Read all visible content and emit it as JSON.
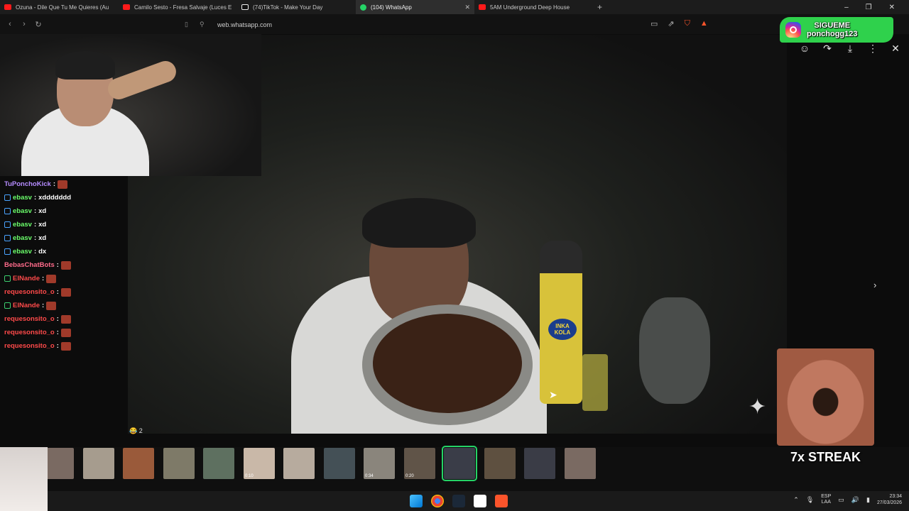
{
  "browser": {
    "tabs": [
      {
        "title": "Ozuna - Dile Que Tu Me Quieres (Au",
        "favicon": "youtube",
        "active": false
      },
      {
        "title": "Camilo Sesto - Fresa Salvaje (Luces E",
        "favicon": "youtube",
        "active": false
      },
      {
        "title": "(74)TikTok - Make Your Day",
        "favicon": "tiktok",
        "active": false
      },
      {
        "title": "(104) WhatsApp",
        "favicon": "whatsapp",
        "active": true
      },
      {
        "title": "5AM Underground Deep House",
        "favicon": "youtube",
        "active": false
      }
    ],
    "url": "web.whatsapp.com",
    "new_tab": "+",
    "window_controls": {
      "minimize": "–",
      "restore": "❐",
      "close": "✕"
    }
  },
  "viewer": {
    "reaction": "😂 2",
    "bottle_brand": "INKA KOLA",
    "thumbnails": [
      {
        "duration": ""
      },
      {
        "duration": ""
      },
      {
        "duration": ""
      },
      {
        "duration": ""
      },
      {
        "duration": ""
      },
      {
        "duration": "0:10"
      },
      {
        "duration": ""
      },
      {
        "duration": ""
      },
      {
        "duration": "0:34"
      },
      {
        "duration": "0:20"
      },
      {
        "duration": "",
        "selected": true
      },
      {
        "duration": ""
      },
      {
        "duration": ""
      },
      {
        "duration": ""
      }
    ]
  },
  "stream_overlay": {
    "promo": {
      "line1": "SIGUEME",
      "line2": "ponchogg123"
    },
    "streak": "7x STREAK",
    "chat": [
      {
        "user": "TuPonchoKick",
        "color": "purple",
        "badge": false,
        "message": "",
        "emote": true
      },
      {
        "user": "ebasv",
        "color": "green",
        "badge": true,
        "message": "xddddddd",
        "emote": false
      },
      {
        "user": "ebasv",
        "color": "green",
        "badge": true,
        "message": "xd",
        "emote": false
      },
      {
        "user": "ebasv",
        "color": "green",
        "badge": true,
        "message": "xd",
        "emote": false
      },
      {
        "user": "ebasv",
        "color": "green",
        "badge": true,
        "message": "xd",
        "emote": false
      },
      {
        "user": "ebasv",
        "color": "green",
        "badge": true,
        "message": "dx",
        "emote": false
      },
      {
        "user": "BebasChatBots",
        "color": "pink",
        "badge": false,
        "message": "",
        "emote": true
      },
      {
        "user": "ElNande",
        "color": "red",
        "badge": true,
        "message": "",
        "emote": true
      },
      {
        "user": "requesonsito_o",
        "color": "red",
        "badge": false,
        "message": "",
        "emote": true
      },
      {
        "user": "ElNande",
        "color": "red",
        "badge": true,
        "message": "",
        "emote": true
      },
      {
        "user": "requesonsito_o",
        "color": "red",
        "badge": false,
        "message": "",
        "emote": true
      },
      {
        "user": "requesonsito_o",
        "color": "red",
        "badge": false,
        "message": "",
        "emote": true
      },
      {
        "user": "requesonsito_o",
        "color": "red",
        "badge": false,
        "message": "",
        "emote": true
      }
    ]
  },
  "taskbar": {
    "language": "ESP",
    "region": "LAA",
    "time": "23:34",
    "date": "27/03/2026"
  },
  "colors": {
    "accent": "#25d366",
    "promo": "#2fd14c"
  }
}
